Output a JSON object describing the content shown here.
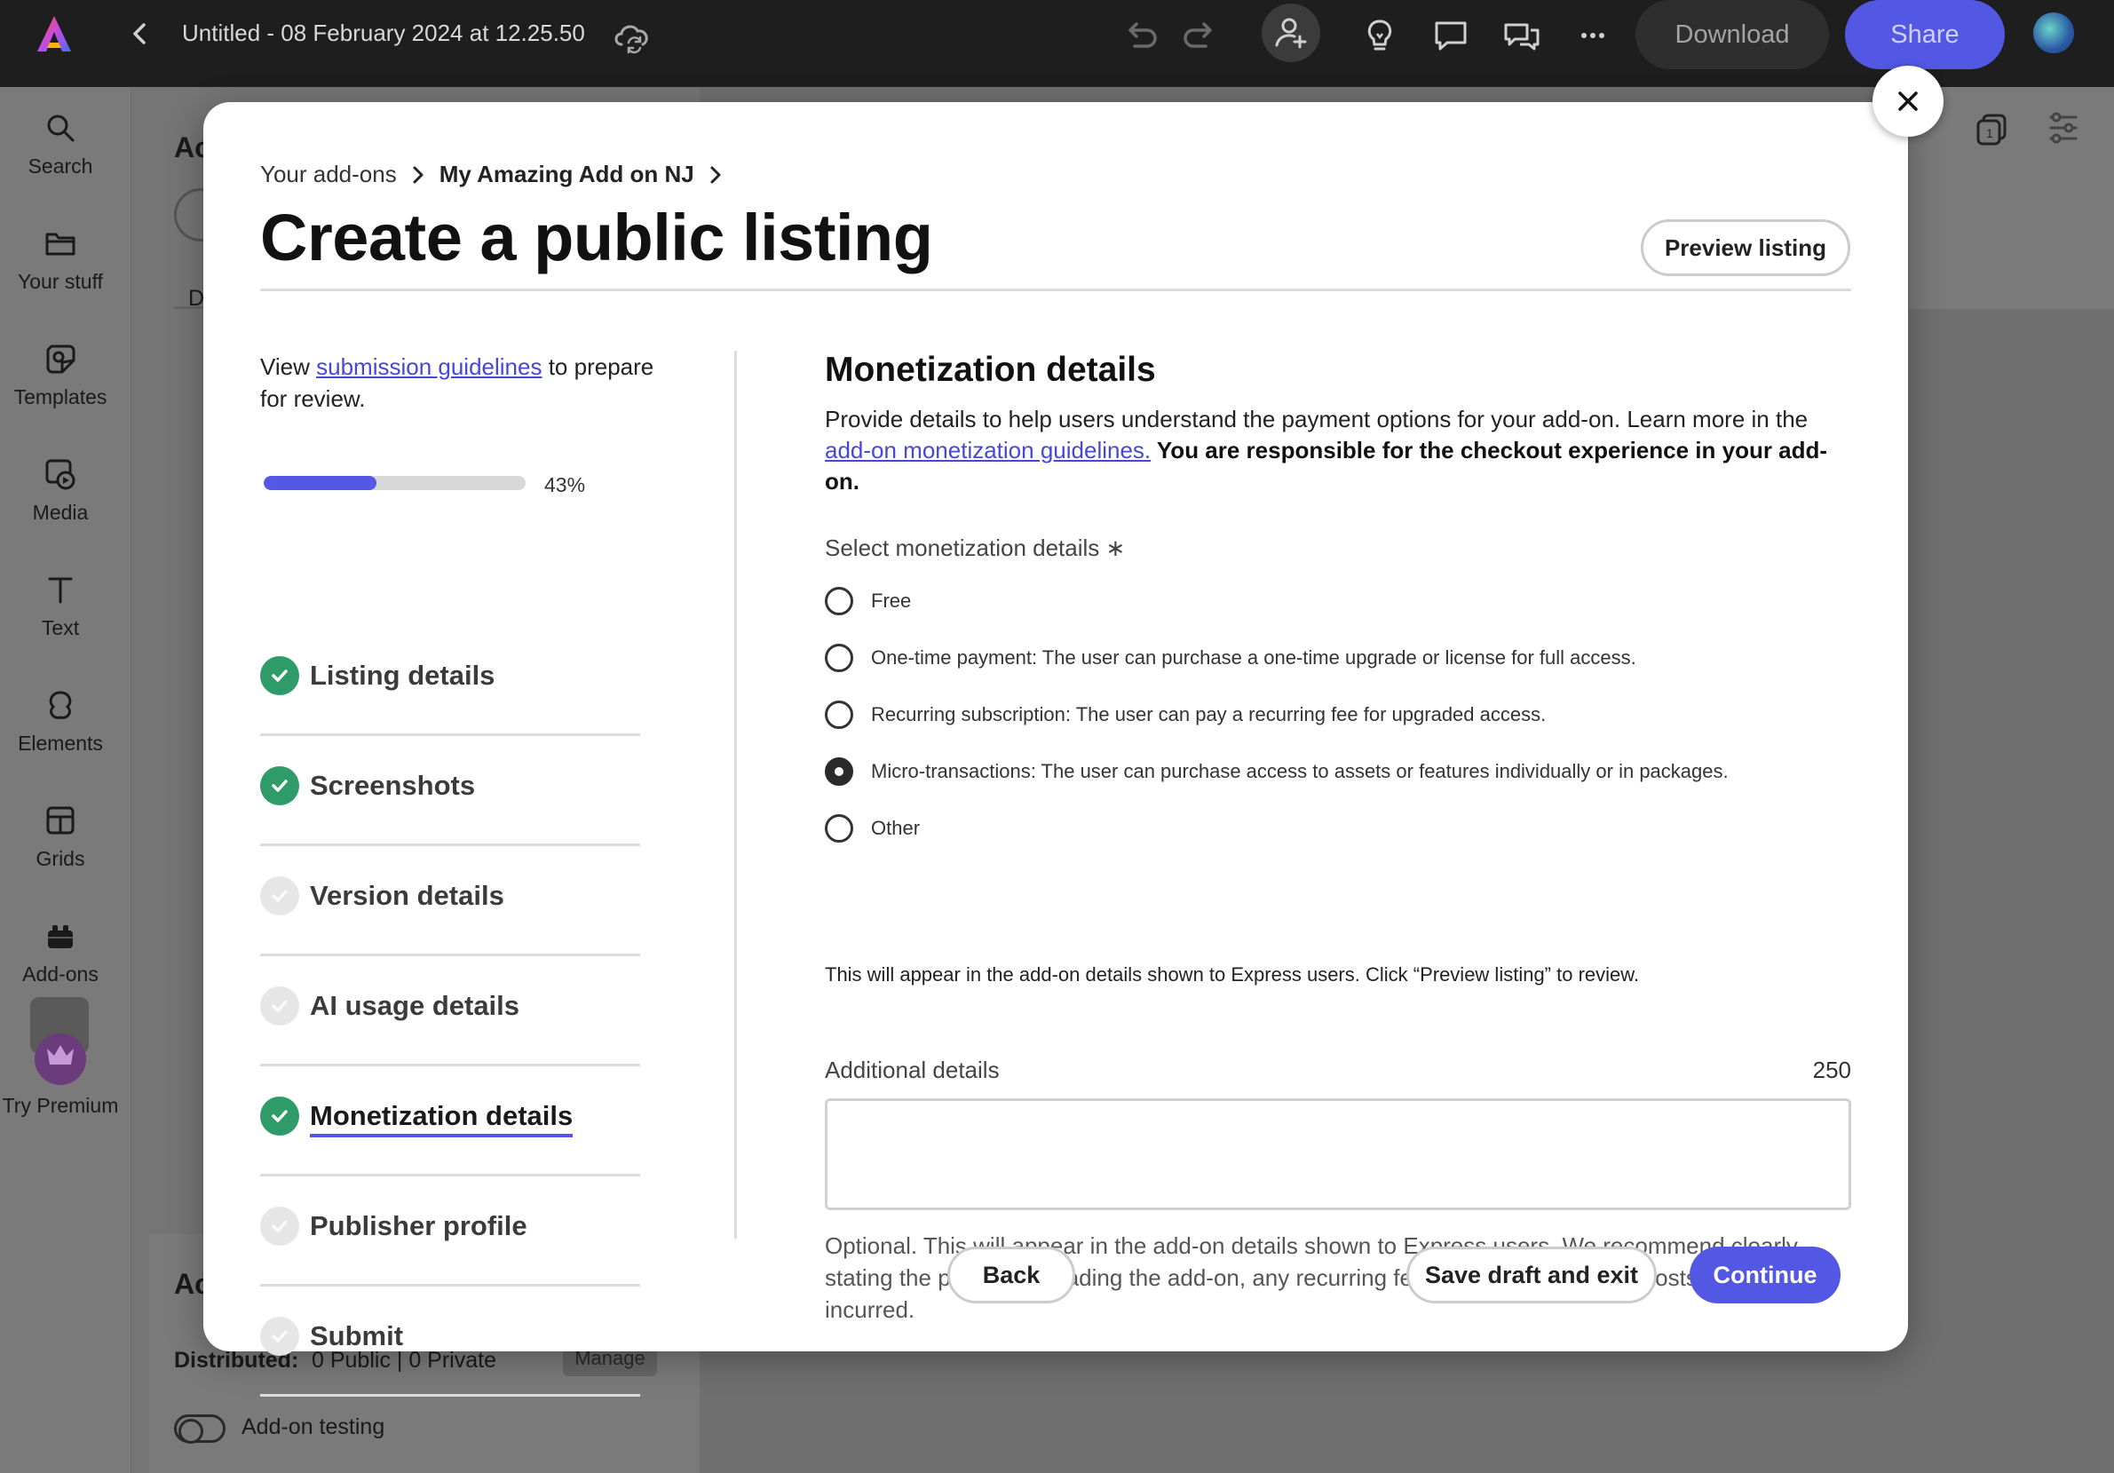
{
  "topbar": {
    "doc_title": "Untitled - 08 February 2024 at 12.25.50",
    "download_label": "Download",
    "share_label": "Share"
  },
  "rail": {
    "items": [
      {
        "label": "Search",
        "icon": "search-icon"
      },
      {
        "label": "Your stuff",
        "icon": "folder-icon"
      },
      {
        "label": "Templates",
        "icon": "templates-icon"
      },
      {
        "label": "Media",
        "icon": "media-icon"
      },
      {
        "label": "Text",
        "icon": "text-icon"
      },
      {
        "label": "Elements",
        "icon": "elements-icon"
      },
      {
        "label": "Grids",
        "icon": "grids-icon"
      },
      {
        "label": "Add-ons",
        "icon": "addons-icon"
      },
      {
        "label": "Try Premium",
        "icon": "crown-icon"
      }
    ]
  },
  "background": {
    "heading_partial": "Ac",
    "tab_partial": "D",
    "card_heading_partial": "Ac",
    "distributed_label": "Distributed:",
    "distributed_value": "0 Public | 0 Private",
    "manage_label": "Manage",
    "testing_label": "Add-on testing"
  },
  "modal": {
    "breadcrumb": {
      "root": "Your add-ons",
      "current": "My Amazing Add on NJ"
    },
    "title": "Create a public listing",
    "preview_label": "Preview listing",
    "guide_prefix": "View ",
    "guide_link": "submission guidelines",
    "guide_suffix": " to prepare for review.",
    "progress": {
      "value": 0.43,
      "label": "43%"
    },
    "steps": [
      {
        "label": "Listing details",
        "status": "done",
        "active": false
      },
      {
        "label": "Screenshots",
        "status": "done",
        "active": false
      },
      {
        "label": "Version details",
        "status": "todo",
        "active": false
      },
      {
        "label": "AI usage details",
        "status": "todo",
        "active": false
      },
      {
        "label": "Monetization details",
        "status": "done",
        "active": true
      },
      {
        "label": "Publisher profile",
        "status": "todo",
        "active": false
      },
      {
        "label": "Submit",
        "status": "todo",
        "active": false
      }
    ],
    "section": {
      "title": "Monetization details",
      "desc_text": "Provide details to help users understand the payment options for your add-on. Learn more in the ",
      "desc_link": "add-on monetization guidelines.",
      "desc_bold": " You are responsible for the checkout experience in your add-on.",
      "select_label": "Select monetization details ∗",
      "options": [
        {
          "label": "Free",
          "selected": false
        },
        {
          "label": "One-time payment: The user can purchase a one-time upgrade or license for full access.",
          "selected": false
        },
        {
          "label": "Recurring subscription: The user can pay a recurring fee for upgraded access.",
          "selected": false
        },
        {
          "label": "Micro-transactions: The user can purchase access to assets or features individually or in packages.",
          "selected": true
        },
        {
          "label": "Other",
          "selected": false
        }
      ],
      "note": "This will appear in the add-on details shown to Express users. Click “Preview listing” to review.",
      "additional_label": "Additional details",
      "additional_count": "250",
      "additional_value": "",
      "help_text": "Optional. This will appear in the add-on details shown to Express users. We recommend clearly stating the price of upgrading the add-on, any recurring fees, and any additional costs that may be incurred."
    },
    "buttons": {
      "back": "Back",
      "save": "Save draft and exit",
      "continue": "Continue"
    }
  },
  "colors": {
    "accent": "#5258e4",
    "success": "#2e9b68",
    "topbar": "#1e1e1e"
  }
}
